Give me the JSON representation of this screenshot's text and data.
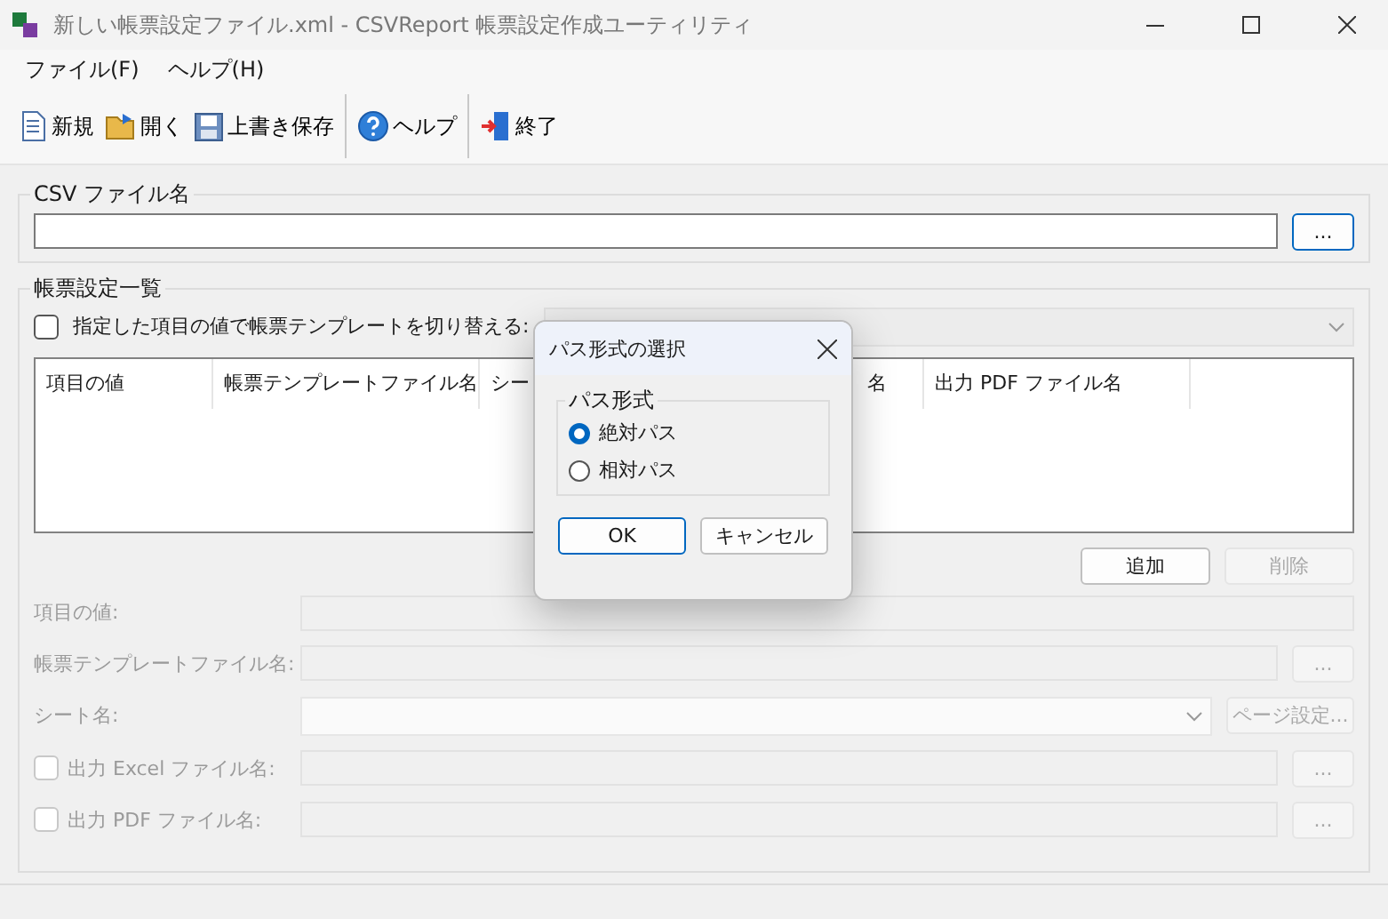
{
  "window": {
    "title": "新しい帳票設定ファイル.xml - CSVReport 帳票設定作成ユーティリティ"
  },
  "menu": [
    "ファイル(F)",
    "ヘルプ(H)"
  ],
  "toolbar": [
    {
      "kind": "new",
      "label": "新規"
    },
    {
      "kind": "open",
      "label": "開く"
    },
    {
      "kind": "save",
      "label": "上書き保存"
    },
    {
      "kind": "help",
      "label": "ヘルプ"
    },
    {
      "kind": "exit",
      "label": "終了"
    }
  ],
  "csv_group": {
    "label": "CSV ファイル名",
    "browse": "..."
  },
  "list_group": {
    "label": "帳票設定一覧",
    "switch": {
      "label": "指定した項目の値で帳票テンプレートを切り替える:",
      "checked": false
    },
    "columns": [
      "項目の値",
      "帳票テンプレートファイル名",
      "シー",
      "名",
      "出力 PDF ファイル名"
    ],
    "buttons": [
      {
        "label": "追加",
        "disabled": false
      },
      {
        "label": "削除",
        "disabled": true
      }
    ],
    "fields": [
      {
        "kind": "text",
        "label": "項目の値:",
        "disabled": true
      },
      {
        "kind": "browse",
        "label": "帳票テンプレートファイル名:",
        "button": "...",
        "disabled": true
      },
      {
        "kind": "combo",
        "label": "シート名:",
        "button": "ページ設定...",
        "disabled": true
      },
      {
        "kind": "check-browse",
        "label": "出力 Excel ファイル名:",
        "button": "...",
        "checked": false,
        "disabled": true
      },
      {
        "kind": "check-browse",
        "label": "出力 PDF ファイル名:",
        "button": "...",
        "checked": false,
        "disabled": true
      }
    ]
  },
  "dialog": {
    "title": "パス形式の選択",
    "group": "パス形式",
    "options": [
      {
        "label": "絶対パス",
        "selected": true
      },
      {
        "label": "相対パス",
        "selected": false
      }
    ],
    "buttons": [
      {
        "label": "OK",
        "kind": "default"
      },
      {
        "label": "キャンセル",
        "kind": "normal"
      }
    ]
  }
}
